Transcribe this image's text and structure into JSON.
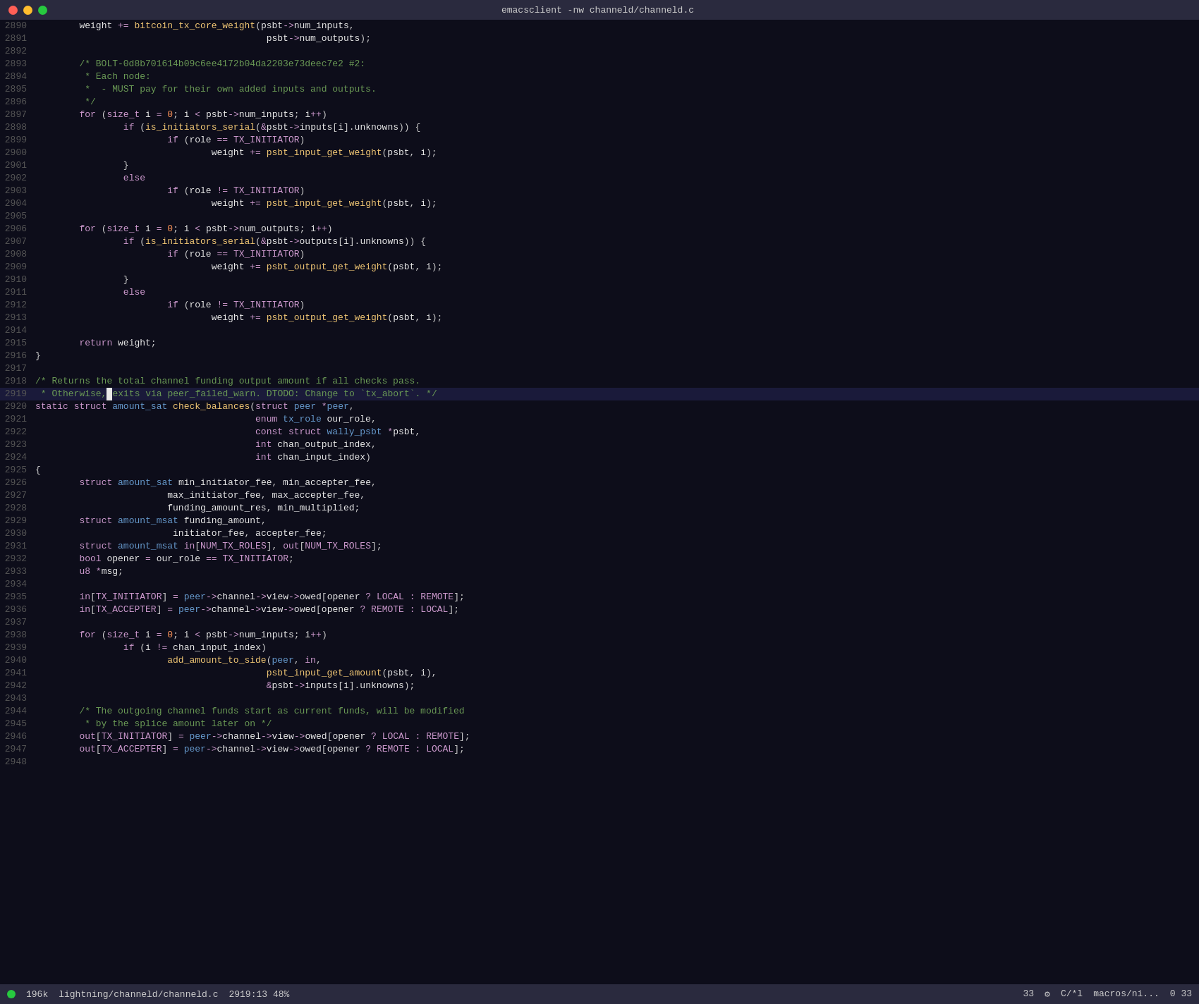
{
  "titleBar": {
    "title": "emacsclient  -nw  channeld/channeld.c",
    "dots": [
      "red",
      "yellow",
      "green"
    ]
  },
  "statusBar": {
    "fileSize": "196k",
    "fileName": "lightning/channeld/channeld.c",
    "position": "2919:13  48%",
    "lineNum": "33",
    "gearIcon": "⚙",
    "mode": "C/*l",
    "macros": "macros/ni...",
    "col": "0 33"
  },
  "lines": [
    {
      "num": "2890",
      "content": "        weight += bitcoin_tx_core_weight(psbt->num_inputs,"
    },
    {
      "num": "2891",
      "content": "                                          psbt->num_outputs);"
    },
    {
      "num": "2892",
      "content": ""
    },
    {
      "num": "2893",
      "content": "        /* BOLT-0d8b701614b09c6ee4172b04da2203e73deec7e2 #2:"
    },
    {
      "num": "2894",
      "content": "         * Each node:"
    },
    {
      "num": "2895",
      "content": "         *  - MUST pay for their own added inputs and outputs."
    },
    {
      "num": "2896",
      "content": "         */"
    },
    {
      "num": "2897",
      "content": "        for (size_t i = 0; i < psbt->num_inputs; i++)"
    },
    {
      "num": "2898",
      "content": "                if (is_initiators_serial(&psbt->inputs[i].unknowns)) {"
    },
    {
      "num": "2899",
      "content": "                        if (role == TX_INITIATOR)"
    },
    {
      "num": "2900",
      "content": "                                weight += psbt_input_get_weight(psbt, i);"
    },
    {
      "num": "2901",
      "content": "                }"
    },
    {
      "num": "2902",
      "content": "                else"
    },
    {
      "num": "2903",
      "content": "                        if (role != TX_INITIATOR)"
    },
    {
      "num": "2904",
      "content": "                                weight += psbt_input_get_weight(psbt, i);"
    },
    {
      "num": "2905",
      "content": ""
    },
    {
      "num": "2906",
      "content": "        for (size_t i = 0; i < psbt->num_outputs; i++)"
    },
    {
      "num": "2907",
      "content": "                if (is_initiators_serial(&psbt->outputs[i].unknowns)) {"
    },
    {
      "num": "2908",
      "content": "                        if (role == TX_INITIATOR)"
    },
    {
      "num": "2909",
      "content": "                                weight += psbt_output_get_weight(psbt, i);"
    },
    {
      "num": "2910",
      "content": "                }"
    },
    {
      "num": "2911",
      "content": "                else"
    },
    {
      "num": "2912",
      "content": "                        if (role != TX_INITIATOR)"
    },
    {
      "num": "2913",
      "content": "                                weight += psbt_output_get_weight(psbt, i);"
    },
    {
      "num": "2914",
      "content": ""
    },
    {
      "num": "2915",
      "content": "        return weight;"
    },
    {
      "num": "2916",
      "content": "}"
    },
    {
      "num": "2917",
      "content": ""
    },
    {
      "num": "2918",
      "content": "/* Returns the total channel funding output amount if all checks pass."
    },
    {
      "num": "2919",
      "content": " * Otherwise, exits via peer_failed_warn. DTODO: Change to `tx_abort`. */",
      "cursor": true
    },
    {
      "num": "2920",
      "content": "static struct amount_sat check_balances(struct peer *peer,"
    },
    {
      "num": "2921",
      "content": "                                        enum tx_role our_role,"
    },
    {
      "num": "2922",
      "content": "                                        const struct wally_psbt *psbt,"
    },
    {
      "num": "2923",
      "content": "                                        int chan_output_index,"
    },
    {
      "num": "2924",
      "content": "                                        int chan_input_index)"
    },
    {
      "num": "2925",
      "content": "{"
    },
    {
      "num": "2926",
      "content": "        struct amount_sat min_initiator_fee, min_accepter_fee,"
    },
    {
      "num": "2927",
      "content": "                        max_initiator_fee, max_accepter_fee,"
    },
    {
      "num": "2928",
      "content": "                        funding_amount_res, min_multiplied;"
    },
    {
      "num": "2929",
      "content": "        struct amount_msat funding_amount,"
    },
    {
      "num": "2930",
      "content": "                         initiator_fee, accepter_fee;"
    },
    {
      "num": "2931",
      "content": "        struct amount_msat in[NUM_TX_ROLES], out[NUM_TX_ROLES];"
    },
    {
      "num": "2932",
      "content": "        bool opener = our_role == TX_INITIATOR;"
    },
    {
      "num": "2933",
      "content": "        u8 *msg;"
    },
    {
      "num": "2934",
      "content": ""
    },
    {
      "num": "2935",
      "content": "        in[TX_INITIATOR] = peer->channel->view->owed[opener ? LOCAL : REMOTE];"
    },
    {
      "num": "2936",
      "content": "        in[TX_ACCEPTER] = peer->channel->view->owed[opener ? REMOTE : LOCAL];"
    },
    {
      "num": "2937",
      "content": ""
    },
    {
      "num": "2938",
      "content": "        for (size_t i = 0; i < psbt->num_inputs; i++)"
    },
    {
      "num": "2939",
      "content": "                if (i != chan_input_index)"
    },
    {
      "num": "2940",
      "content": "                        add_amount_to_side(peer, in,"
    },
    {
      "num": "2941",
      "content": "                                          psbt_input_get_amount(psbt, i),"
    },
    {
      "num": "2942",
      "content": "                                          &psbt->inputs[i].unknowns);"
    },
    {
      "num": "2943",
      "content": ""
    },
    {
      "num": "2944",
      "content": "        /* The outgoing channel funds start as current funds, will be modified"
    },
    {
      "num": "2945",
      "content": "         * by the splice amount later on */"
    },
    {
      "num": "2946",
      "content": "        out[TX_INITIATOR] = peer->channel->view->owed[opener ? LOCAL : REMOTE];"
    },
    {
      "num": "2947",
      "content": "        out[TX_ACCEPTER] = peer->channel->view->owed[opener ? REMOTE : LOCAL];"
    },
    {
      "num": "2948",
      "content": ""
    }
  ]
}
